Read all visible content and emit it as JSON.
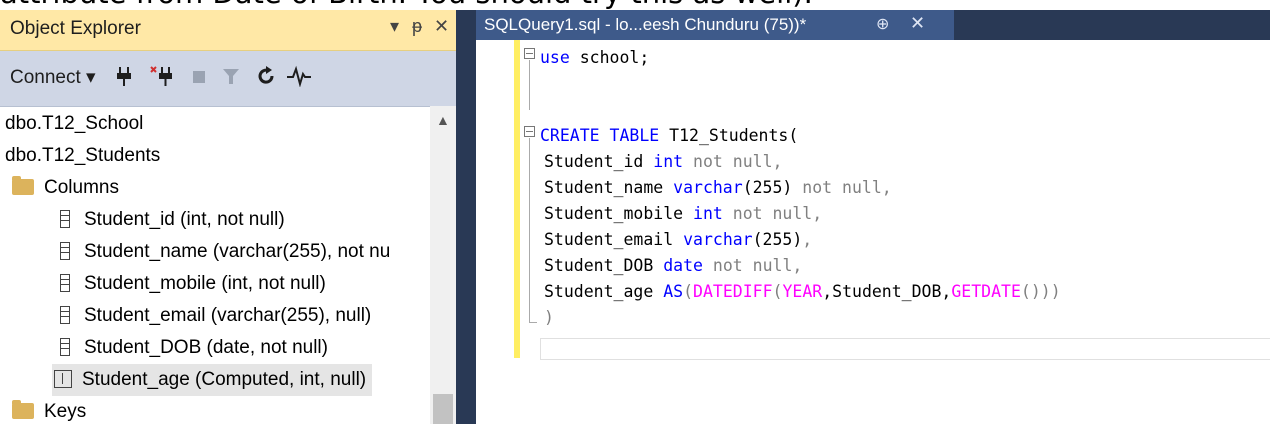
{
  "caption": {
    "cut_text": "attribute from Date of Birth. You should try this as well)."
  },
  "object_explorer": {
    "title": "Object Explorer",
    "title_controls": [
      "▾",
      "ᵽ",
      "✕"
    ],
    "toolbar": {
      "connect_label": "Connect ▾"
    },
    "tree": [
      {
        "label": "dbo.T12_School",
        "type": "table"
      },
      {
        "label": "dbo.T12_Students",
        "type": "table"
      },
      {
        "label": "Columns",
        "type": "folder"
      },
      {
        "label": "Student_id (int, not null)",
        "type": "column"
      },
      {
        "label": "Student_name (varchar(255), not nu",
        "type": "column"
      },
      {
        "label": "Student_mobile (int, not null)",
        "type": "column"
      },
      {
        "label": "Student_email (varchar(255), null)",
        "type": "column"
      },
      {
        "label": "Student_DOB (date, not null)",
        "type": "column"
      },
      {
        "label": "Student_age (Computed, int, null)",
        "type": "computed",
        "selected": true
      },
      {
        "label": "Keys",
        "type": "folder"
      }
    ]
  },
  "editor": {
    "tab_title": "SQLQuery1.sql - lo...eesh Chunduru (75))*",
    "tab_pin": "⊕",
    "tab_close": "✕",
    "code": {
      "l1_kw": "use",
      "l1_rest": " school;",
      "l3_kw": "CREATE TABLE",
      "l3_rest": " T12_Students(",
      "l4_a": "Student_id ",
      "l4_kw": "int",
      "l4_g": " not null",
      "l5_a": "Student_name ",
      "l5_kw": "varchar",
      "l5_b": "(255)",
      "l5_g": " not null",
      "l6_a": "Student_mobile ",
      "l6_kw": "int",
      "l6_g": " not null",
      "l7_a": "Student_email ",
      "l7_kw": "varchar",
      "l7_b": "(255)",
      "l8_a": "Student_DOB ",
      "l8_kw": "date",
      "l8_g": " not null",
      "l9_a": "Student_age ",
      "l9_kw": "AS",
      "l9_g1": "(",
      "l9_f1": "DATEDIFF",
      "l9_g2": "(",
      "l9_f2": "YEAR",
      "l9_b": ",Student_DOB,",
      "l9_f3": "GETDATE",
      "l9_g3": "()))",
      "l10": ")"
    }
  },
  "colors": {
    "title_bar": "#ffe8a6",
    "toolbar": "#cfd6e5",
    "tab_active": "#3e5a8a",
    "frame": "#293955",
    "keyword": "#0000ff",
    "function": "#ff00ff",
    "gray_text": "#808080",
    "change_bar": "#ffee62"
  }
}
